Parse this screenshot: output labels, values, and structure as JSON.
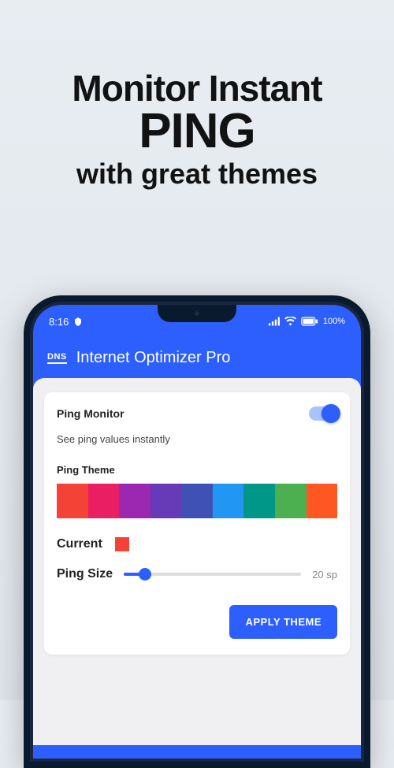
{
  "promo": {
    "line1": "Monitor Instant",
    "line2": "PING",
    "line3": "with great themes"
  },
  "statusBar": {
    "time": "8:16",
    "battery": "100%"
  },
  "app": {
    "logo": "DNS",
    "title": "Internet Optimizer Pro"
  },
  "card": {
    "pingMonitorTitle": "Ping Monitor",
    "pingMonitorSubtitle": "See ping values instantly",
    "pingThemeLabel": "Ping Theme",
    "themeColors": [
      "#f44336",
      "#e91e63",
      "#9c27b0",
      "#673ab7",
      "#3f51b5",
      "#2196f3",
      "#009688",
      "#4caf50",
      "#ff5722"
    ],
    "currentLabel": "Current",
    "currentColor": "#f44336",
    "pingSizeLabel": "Ping Size",
    "pingSizeValue": "20 sp",
    "applyButton": "APPLY THEME"
  }
}
